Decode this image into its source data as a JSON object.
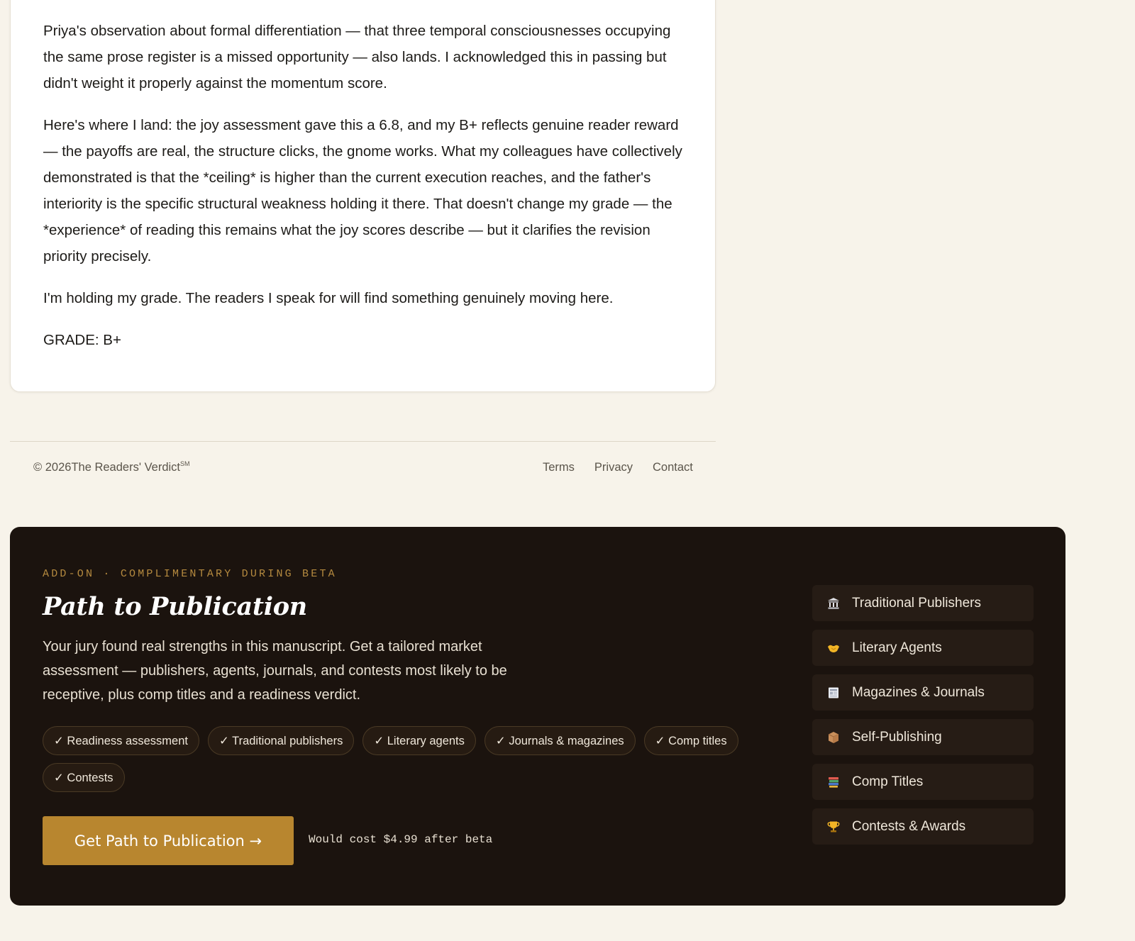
{
  "review": {
    "paragraphs": [
      "Priya's observation about formal differentiation — that three temporal consciousnesses occupying the same prose register is a missed opportunity — also lands. I acknowledged this in passing but didn't weight it properly against the momentum score.",
      "Here's where I land: the joy assessment gave this a 6.8, and my B+ reflects genuine reader reward — the payoffs are real, the structure clicks, the gnome works. What my colleagues have collectively demonstrated is that the *ceiling* is higher than the current execution reaches, and the father's interiority is the specific structural weakness holding it there. That doesn't change my grade — the *experience* of reading this remains what the joy scores describe — but it clarifies the revision priority precisely.",
      "I'm holding my grade. The readers I speak for will find something genuinely moving here."
    ],
    "grade": "GRADE: B+"
  },
  "footer": {
    "copyright": "© 2026The Readers' Verdict",
    "service_mark": "SM",
    "links": {
      "terms": "Terms",
      "privacy": "Privacy",
      "contact": "Contact"
    }
  },
  "addon": {
    "eyebrow": "ADD-ON · COMPLIMENTARY DURING BETA",
    "title": "Path to Publication",
    "description": "Your jury found real strengths in this manuscript. Get a tailored market assessment — publishers, agents, journals, and contests most likely to be receptive, plus comp titles and a readiness verdict.",
    "chips": [
      "✓ Readiness assessment",
      "✓ Traditional publishers",
      "✓ Literary agents",
      "✓ Journals & magazines",
      "✓ Comp titles",
      "✓ Contests"
    ],
    "cta_label": "Get Path to Publication →",
    "cta_note": "Would cost $4.99 after beta",
    "markets": [
      {
        "label": "Traditional Publishers",
        "icon": "classical-building-icon"
      },
      {
        "label": "Literary Agents",
        "icon": "handshake-icon"
      },
      {
        "label": "Magazines & Journals",
        "icon": "newspaper-icon"
      },
      {
        "label": "Self-Publishing",
        "icon": "package-icon"
      },
      {
        "label": "Comp Titles",
        "icon": "books-icon"
      },
      {
        "label": "Contests & Awards",
        "icon": "trophy-icon"
      }
    ]
  },
  "colors": {
    "page_bg": "#f7f3ea",
    "card_bg": "#ffffff",
    "panel_bg": "#1b130e",
    "accent_gold": "#b8862f",
    "eyebrow_gold": "#b58a3f"
  }
}
